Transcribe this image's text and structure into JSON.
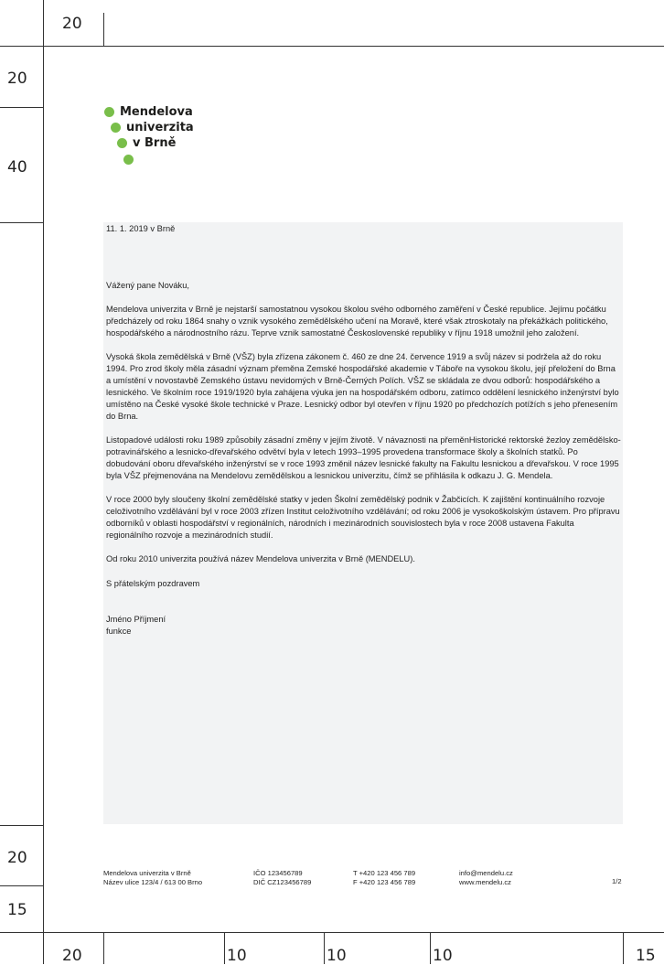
{
  "margins": {
    "top_left": "20",
    "left_top": "20",
    "left_logo": "40",
    "left_footer_a": "20",
    "left_footer_b": "15",
    "bottom": [
      "20",
      "10",
      "10",
      "10",
      "15"
    ]
  },
  "logo": {
    "line1": "Mendelova",
    "line2": "univerzita",
    "line3": "v Brně",
    "dot_color": "#79be4a"
  },
  "letter": {
    "date": "11. 1. 2019 v Brně",
    "salutation": "Vážený pane Nováku,",
    "paragraphs": [
      "Mendelova univerzita v Brně je nejstarší samostatnou vysokou školou svého odborného zaměření v České republice. Jejímu počátku předcházely od roku 1864 snahy o vznik vysokého zemědělského učení na Moravě, které však ztroskotaly na překážkách politického, hospodářského a národnostního rázu. Teprve vznik samostatné Československé republiky v říjnu 1918 umožnil jeho založení.",
      "Vysoká škola zemědělská v Brně (VŠZ) byla zřízena zákonem č. 460 ze dne 24. července 1919 a svůj název si podržela až do roku 1994. Pro zrod školy měla zásadní význam přeměna Zemské hospodářské akademie v Táboře na vysokou školu, její přeložení do Brna a umístění v novostavbě Zemského ústavu nevidomých v Brně-Černých Polích. VŠZ se skládala ze dvou odborů: hospodářského a lesnického. Ve školním roce 1919/1920 byla zahájena výuka jen na hospodářském odboru, zatímco oddělení lesnického inženýrství bylo umístěno na České vysoké škole technické v Praze. Lesnický odbor byl otevřen v říjnu 1920 po předchozích potížích s jeho přenesením do Brna.",
      "Listopadové události roku 1989 způsobily zásadní změny v jejím životě. V návaznosti na přeměnHistorické rektorské žezloy zemědělsko-potravinářského a lesnicko-dřevařského odvětví byla v letech 1993–1995 provedena transformace školy a školních statků. Po dobudování oboru dřevařského inženýrství se v roce 1993 změnil název lesnické fakulty na Fakultu lesnickou a dřevařskou. V roce 1995 byla VŠZ přejmenována na Mendelovu zemědělskou a lesnickou univerzitu, čímž se přihlásila k odkazu J. G. Mendela.",
      "V roce 2000 byly sloučeny školní zemědělské statky v jeden Školní zemědělský podnik v Žabčicích. K zajištění kontinuálního rozvoje celoživotního vzdělávání byl v roce 2003 zřízen Institut celoživotního vzdělávání; od roku 2006 je vysokoškolským ústavem. Pro přípravu odborníků v oblasti hospodářství v regionálních, národních i mezinárodních souvislostech byla v roce 2008 ustavena Fakulta regionálního rozvoje a mezinárodních studií.",
      "Od roku 2010 univerzita používá název Mendelova univerzita v Brně (MENDELU)."
    ],
    "closing": "S přátelským pozdravem",
    "signature_name": "Jméno Příjmení",
    "signature_role": "funkce"
  },
  "footer": {
    "org_name": "Mendelova univerzita v Brně",
    "org_address": "Název ulice 123/4 / 613 00 Brno",
    "ico": "IČO 123456789",
    "dic": "DIČ CZ123456789",
    "tel": "T +420 123 456 789",
    "fax": "F +420 123 456 789",
    "email": "info@mendelu.cz",
    "web": "www.mendelu.cz",
    "page": "1/2"
  }
}
